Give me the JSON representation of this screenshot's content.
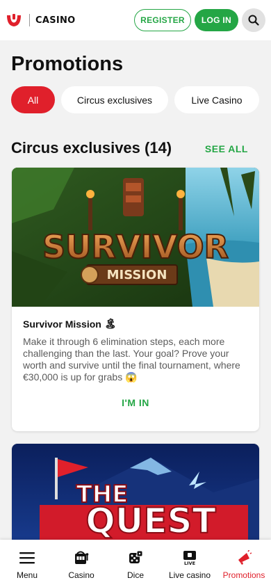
{
  "header": {
    "brand": "CASINO",
    "register_label": "REGISTER",
    "login_label": "LOG IN",
    "search_icon": "search-icon"
  },
  "page": {
    "title": "Promotions"
  },
  "filters": [
    {
      "label": "All",
      "active": true
    },
    {
      "label": "Circus exclusives",
      "active": false
    },
    {
      "label": "Live Casino",
      "active": false
    }
  ],
  "section": {
    "title": "Circus exclusives (14)",
    "see_all": "SEE ALL"
  },
  "cards": [
    {
      "image_title": "SURVIVOR",
      "image_subtitle": "MISSION",
      "title": "Survivor Mission",
      "title_emoji": "🏝",
      "description": "Make it through 6 elimination steps, each more challenging than the last. Your goal? Prove your worth and survive until the final tournament, where €30,000 is up for grabs 😱",
      "cta": "I'M IN"
    },
    {
      "image_title_1": "THE",
      "image_title_2": "QUEST"
    }
  ],
  "bottom_nav": [
    {
      "label": "Menu",
      "icon": "menu-icon",
      "active": false
    },
    {
      "label": "Casino",
      "icon": "slot-machine-icon",
      "active": false
    },
    {
      "label": "Dice",
      "icon": "dice-icon",
      "active": false
    },
    {
      "label": "Live casino",
      "icon": "live-tv-icon",
      "active": false
    },
    {
      "label": "Promotions",
      "icon": "megaphone-icon",
      "active": true
    }
  ],
  "colors": {
    "brand_red": "#e0202b",
    "accent_green": "#24a645",
    "background": "#f2f2f2"
  }
}
